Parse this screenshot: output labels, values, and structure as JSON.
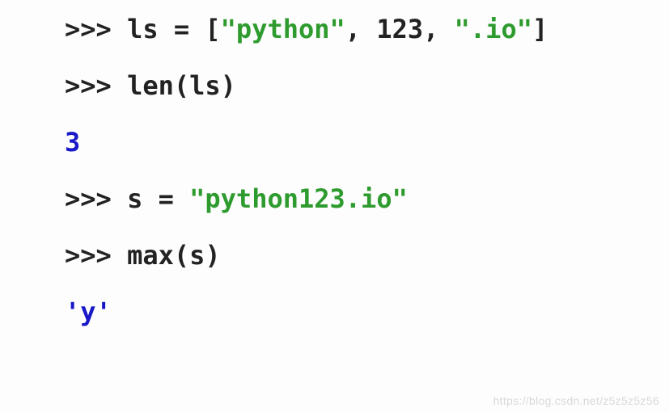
{
  "repl": {
    "prompt": ">>> ",
    "lines": {
      "l1": {
        "var": "ls",
        "eq": " = ",
        "lb": "[",
        "s1": "\"python\"",
        "c1": ", ",
        "n1": "123",
        "c2": ", ",
        "s2": "\".io\"",
        "rb": "]"
      },
      "l2": {
        "call": "len(ls)"
      },
      "o1": "3",
      "l3": {
        "var": "s",
        "eq": " = ",
        "s1": "\"python123.io\""
      },
      "l4": {
        "call": "max(s)"
      },
      "o2": "'y'"
    }
  },
  "watermark": "https://blog.csdn.net/z5z5z5z56"
}
